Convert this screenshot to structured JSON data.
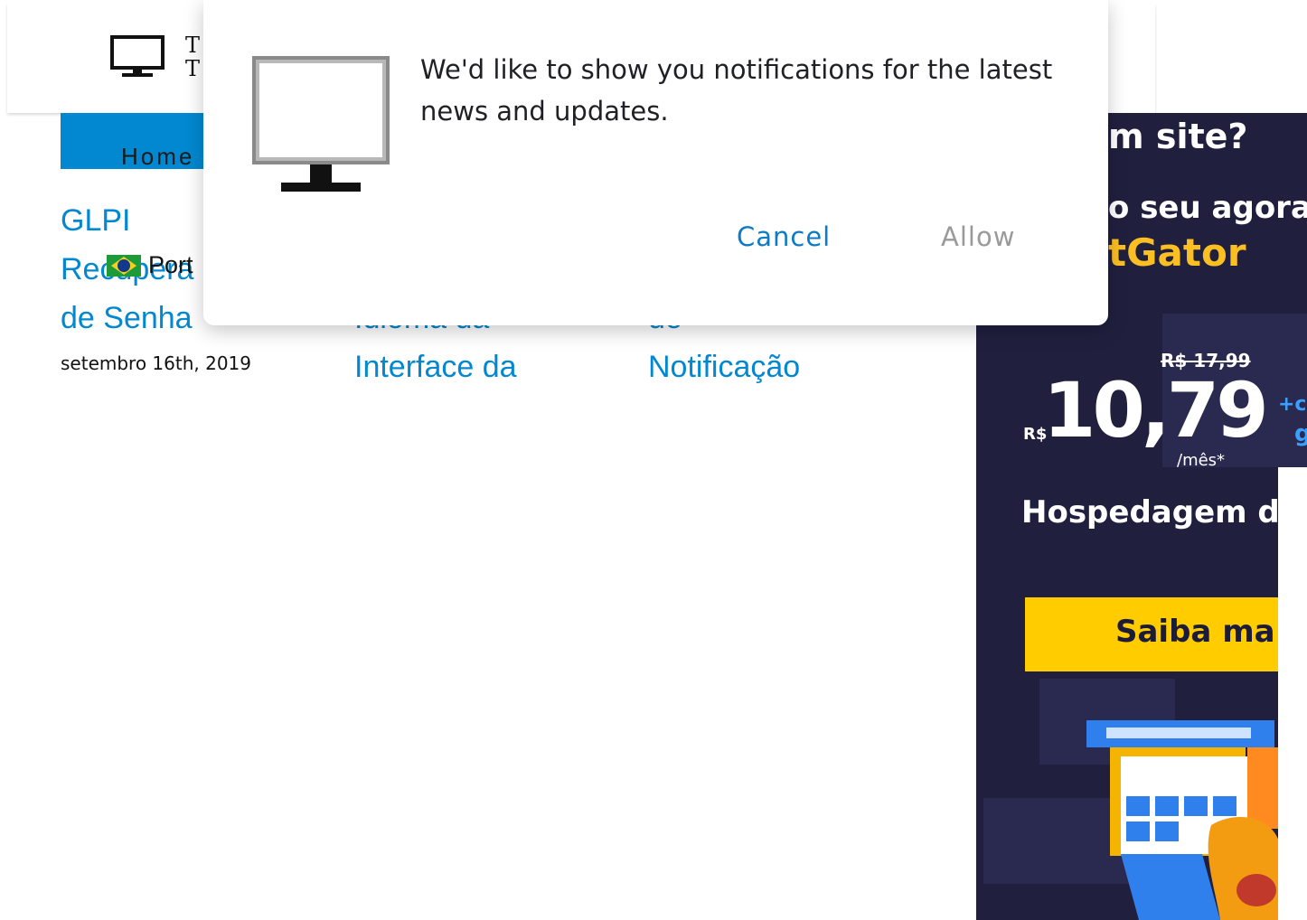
{
  "header": {
    "logo_text_line1": "T",
    "logo_text_line2": "T"
  },
  "nav": {
    "home_label": "Home"
  },
  "posts": [
    {
      "title_lines": [
        "GLPI",
        "Recupera",
        "de Senha"
      ],
      "date": "setembro 16th, 2019"
    },
    {
      "title_lines": [
        "Idioma da",
        "Interface da"
      ]
    },
    {
      "title_lines": [
        "de",
        "Notificação"
      ]
    }
  ],
  "language": {
    "label": "Port",
    "flag_icon": "brazil-flag-icon"
  },
  "ad": {
    "line1": "m site?",
    "line2": "o seu agora",
    "brand": "tGator",
    "old_price": "R$ 17,99",
    "currency": "R$",
    "price": "10,79",
    "per": "/mês*",
    "plus_a": "+c",
    "plus_b": "g",
    "headline": "Hospedagem d",
    "cta": "Saiba ma",
    "colors": {
      "background": "#201f3e",
      "accent": "#ffcc00",
      "brand": "#fbbf24"
    }
  },
  "dialog": {
    "icon": "monitor-icon",
    "message": "We'd like to show you notifications for the latest news and updates.",
    "cancel_label": "Cancel",
    "allow_label": "Allow",
    "colors": {
      "cancel": "#0b7bc7",
      "allow": "#9a9a9a"
    }
  },
  "colors": {
    "nav_bar": "#0288d1",
    "link": "#0288d1"
  }
}
